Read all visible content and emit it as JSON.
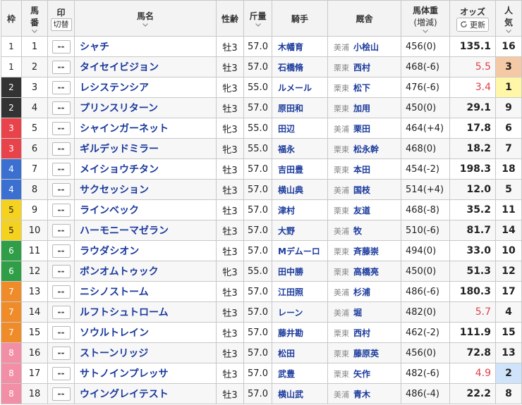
{
  "headers": {
    "waku": "枠",
    "umaban_line1": "馬",
    "umaban_line2": "番",
    "mark_label": "印",
    "mark_toggle": "切替",
    "horse_name": "馬名",
    "sex_age": "性齢",
    "weight": "斤量",
    "jockey": "騎手",
    "stable": "厩舎",
    "body_weight": "馬体重",
    "body_weight_sub": "(増減)",
    "odds": "オッズ",
    "refresh": "更新",
    "popularity_line1": "人",
    "popularity_line2": "気"
  },
  "colors": {
    "waku": {
      "1": {
        "bg": "#ffffff",
        "fg": "#222222"
      },
      "2": {
        "bg": "#333333",
        "fg": "#ffffff"
      },
      "3": {
        "bg": "#e8434b",
        "fg": "#ffffff"
      },
      "4": {
        "bg": "#3b6fd0",
        "fg": "#ffffff"
      },
      "5": {
        "bg": "#f4d21f",
        "fg": "#222222"
      },
      "6": {
        "bg": "#2f9e47",
        "fg": "#ffffff"
      },
      "7": {
        "bg": "#f08b2a",
        "fg": "#ffffff"
      },
      "8": {
        "bg": "#f28fa6",
        "fg": "#ffffff"
      }
    },
    "odds_favored": "#e0414a",
    "pop_1_bg": "#fff6a8",
    "pop_2_bg": "#cfe3fb",
    "pop_3_bg": "#f6c9a6"
  },
  "rows": [
    {
      "waku": "1",
      "umaban": "1",
      "mark": "--",
      "name": "シャチ",
      "sexage": "牡3",
      "weight": "57.0",
      "jockey": "木幡育",
      "region": "美浦",
      "trainer": "小桧山",
      "bw": "456(0)",
      "odds": "135.1",
      "pop": "16",
      "odds_hl": false,
      "pop_hl": ""
    },
    {
      "waku": "1",
      "umaban": "2",
      "mark": "--",
      "name": "タイセイビジョン",
      "sexage": "牡3",
      "weight": "57.0",
      "jockey": "石橋脩",
      "region": "栗東",
      "trainer": "西村",
      "bw": "468(-6)",
      "odds": "5.5",
      "pop": "3",
      "odds_hl": true,
      "pop_hl": "3"
    },
    {
      "waku": "2",
      "umaban": "3",
      "mark": "--",
      "name": "レシステンシア",
      "sexage": "牝3",
      "weight": "55.0",
      "jockey": "ルメール",
      "region": "栗東",
      "trainer": "松下",
      "bw": "476(-6)",
      "odds": "3.4",
      "pop": "1",
      "odds_hl": true,
      "pop_hl": "1"
    },
    {
      "waku": "2",
      "umaban": "4",
      "mark": "--",
      "name": "プリンスリターン",
      "sexage": "牡3",
      "weight": "57.0",
      "jockey": "原田和",
      "region": "栗東",
      "trainer": "加用",
      "bw": "450(0)",
      "odds": "29.1",
      "pop": "9",
      "odds_hl": false,
      "pop_hl": ""
    },
    {
      "waku": "3",
      "umaban": "5",
      "mark": "--",
      "name": "シャインガーネット",
      "sexage": "牝3",
      "weight": "55.0",
      "jockey": "田辺",
      "region": "美浦",
      "trainer": "栗田",
      "bw": "464(+4)",
      "odds": "17.8",
      "pop": "6",
      "odds_hl": false,
      "pop_hl": ""
    },
    {
      "waku": "3",
      "umaban": "6",
      "mark": "--",
      "name": "ギルデッドミラー",
      "sexage": "牝3",
      "weight": "55.0",
      "jockey": "福永",
      "region": "栗東",
      "trainer": "松永幹",
      "bw": "468(0)",
      "odds": "18.2",
      "pop": "7",
      "odds_hl": false,
      "pop_hl": ""
    },
    {
      "waku": "4",
      "umaban": "7",
      "mark": "--",
      "name": "メイショウチタン",
      "sexage": "牡3",
      "weight": "57.0",
      "jockey": "吉田豊",
      "region": "栗東",
      "trainer": "本田",
      "bw": "454(-2)",
      "odds": "198.3",
      "pop": "18",
      "odds_hl": false,
      "pop_hl": ""
    },
    {
      "waku": "4",
      "umaban": "8",
      "mark": "--",
      "name": "サクセッション",
      "sexage": "牡3",
      "weight": "57.0",
      "jockey": "横山典",
      "region": "美浦",
      "trainer": "国枝",
      "bw": "514(+4)",
      "odds": "12.0",
      "pop": "5",
      "odds_hl": false,
      "pop_hl": ""
    },
    {
      "waku": "5",
      "umaban": "9",
      "mark": "--",
      "name": "ラインベック",
      "sexage": "牡3",
      "weight": "57.0",
      "jockey": "津村",
      "region": "栗東",
      "trainer": "友道",
      "bw": "468(-8)",
      "odds": "35.2",
      "pop": "11",
      "odds_hl": false,
      "pop_hl": ""
    },
    {
      "waku": "5",
      "umaban": "10",
      "mark": "--",
      "name": "ハーモニーマゼラン",
      "sexage": "牡3",
      "weight": "57.0",
      "jockey": "大野",
      "region": "美浦",
      "trainer": "牧",
      "bw": "510(-6)",
      "odds": "81.7",
      "pop": "14",
      "odds_hl": false,
      "pop_hl": ""
    },
    {
      "waku": "6",
      "umaban": "11",
      "mark": "--",
      "name": "ラウダシオン",
      "sexage": "牡3",
      "weight": "57.0",
      "jockey": "Mデムーロ",
      "region": "栗東",
      "trainer": "斉藤崇",
      "bw": "494(0)",
      "odds": "33.0",
      "pop": "10",
      "odds_hl": false,
      "pop_hl": ""
    },
    {
      "waku": "6",
      "umaban": "12",
      "mark": "--",
      "name": "ボンオムトゥック",
      "sexage": "牝3",
      "weight": "55.0",
      "jockey": "田中勝",
      "region": "栗東",
      "trainer": "高橋亮",
      "bw": "450(0)",
      "odds": "51.3",
      "pop": "12",
      "odds_hl": false,
      "pop_hl": ""
    },
    {
      "waku": "7",
      "umaban": "13",
      "mark": "--",
      "name": "ニシノストーム",
      "sexage": "牡3",
      "weight": "57.0",
      "jockey": "江田照",
      "region": "美浦",
      "trainer": "杉浦",
      "bw": "486(-6)",
      "odds": "180.3",
      "pop": "17",
      "odds_hl": false,
      "pop_hl": ""
    },
    {
      "waku": "7",
      "umaban": "14",
      "mark": "--",
      "name": "ルフトシュトローム",
      "sexage": "牡3",
      "weight": "57.0",
      "jockey": "レーン",
      "region": "美浦",
      "trainer": "堀",
      "bw": "482(0)",
      "odds": "5.7",
      "pop": "4",
      "odds_hl": true,
      "pop_hl": ""
    },
    {
      "waku": "7",
      "umaban": "15",
      "mark": "--",
      "name": "ソウルトレイン",
      "sexage": "牡3",
      "weight": "57.0",
      "jockey": "藤井勘",
      "region": "栗東",
      "trainer": "西村",
      "bw": "462(-2)",
      "odds": "111.9",
      "pop": "15",
      "odds_hl": false,
      "pop_hl": ""
    },
    {
      "waku": "8",
      "umaban": "16",
      "mark": "--",
      "name": "ストーンリッジ",
      "sexage": "牡3",
      "weight": "57.0",
      "jockey": "松田",
      "region": "栗東",
      "trainer": "藤原英",
      "bw": "456(0)",
      "odds": "72.8",
      "pop": "13",
      "odds_hl": false,
      "pop_hl": ""
    },
    {
      "waku": "8",
      "umaban": "17",
      "mark": "--",
      "name": "サトノインプレッサ",
      "sexage": "牡3",
      "weight": "57.0",
      "jockey": "武豊",
      "region": "栗東",
      "trainer": "矢作",
      "bw": "482(-6)",
      "odds": "4.9",
      "pop": "2",
      "odds_hl": true,
      "pop_hl": "2"
    },
    {
      "waku": "8",
      "umaban": "18",
      "mark": "--",
      "name": "ウイングレイテスト",
      "sexage": "牡3",
      "weight": "57.0",
      "jockey": "横山武",
      "region": "美浦",
      "trainer": "青木",
      "bw": "486(-4)",
      "odds": "22.2",
      "pop": "8",
      "odds_hl": false,
      "pop_hl": ""
    }
  ]
}
